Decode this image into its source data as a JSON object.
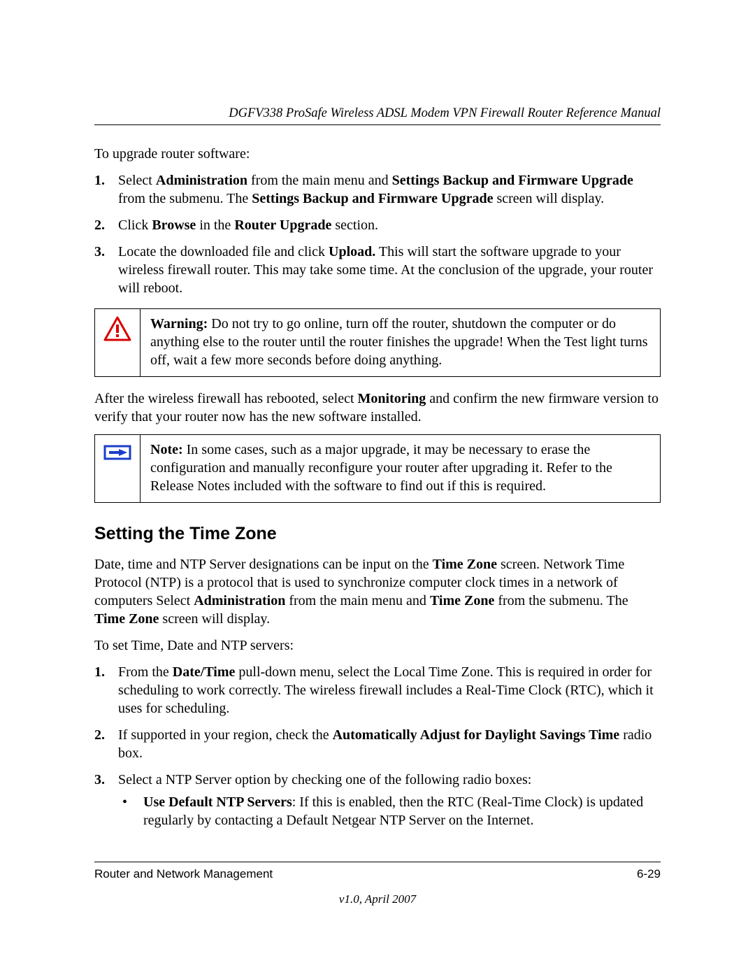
{
  "header": {
    "title": "DGFV338 ProSafe Wireless ADSL Modem VPN Firewall Router Reference Manual"
  },
  "intro": "To upgrade router software:",
  "steps1": {
    "s1": {
      "num": "1.",
      "t1": "Select ",
      "b1": "Administration",
      "t2": " from the main menu and ",
      "b2": "Settings Backup and Firmware Upgrade",
      "t3": " from the submenu. The ",
      "b3": "Settings Backup and Firmware Upgrade",
      "t4": " screen will display."
    },
    "s2": {
      "num": "2.",
      "t1": "Click ",
      "b1": "Browse",
      "t2": " in the ",
      "b2": "Router Upgrade",
      "t3": " section."
    },
    "s3": {
      "num": "3.",
      "t1": "Locate the downloaded file and click ",
      "b1": "Upload.",
      "t2": " This will start the software upgrade to your wireless firewall router. This may take some time. At the conclusion of the upgrade, your router will reboot."
    }
  },
  "warningBox": {
    "label": "Warning:",
    "text": " Do not try to go online, turn off the router, shutdown the computer or do anything else to the router until the router finishes the upgrade! When the Test light turns off, wait a few more seconds before doing anything."
  },
  "afterWarning": {
    "t1": "After the wireless firewall has rebooted, select ",
    "b1": "Monitoring",
    "t2": " and confirm the new firmware version to verify that your router now has the new software installed."
  },
  "noteBox": {
    "label": "Note:",
    "text": " In some cases, such as a major upgrade, it may be necessary to erase the configuration and manually reconfigure your router after upgrading it. Refer to the Release Notes included with the software to find out if this is required."
  },
  "section": {
    "heading": "Setting the Time Zone",
    "p1": {
      "t1": "Date, time and NTP Server designations can be input on the ",
      "b1": "Time Zone",
      "t2": " screen. Network Time Protocol (NTP) is a protocol that is used to synchronize computer clock times in a network of computers Select ",
      "b2": "Administration",
      "t3": " from the main menu and ",
      "b3": "Time Zone",
      "t4": " from the submenu. The ",
      "b4": "Time Zone",
      "t5": " screen will display."
    },
    "p2": "To set Time, Date and NTP servers:"
  },
  "steps2": {
    "s1": {
      "num": "1.",
      "t1": "From the ",
      "b1": "Date/Time",
      "t2": " pull-down menu, select the Local Time Zone. This is required in order for scheduling to work correctly. The wireless firewall includes a Real-Time Clock (RTC), which it uses for scheduling."
    },
    "s2": {
      "num": "2.",
      "t1": "If supported in your region, check the ",
      "b1": "Automatically Adjust for Daylight Savings Time",
      "t2": " radio box."
    },
    "s3": {
      "num": "3.",
      "text": "Select a NTP Server option by checking one of the following radio boxes:",
      "bullet": {
        "dot": "•",
        "b1": "Use Default NTP Servers",
        "t1": ": If this is enabled, then the RTC (Real-Time Clock) is updated regularly by contacting a Default Netgear NTP Server on the Internet."
      }
    }
  },
  "footer": {
    "left": "Router and Network Management",
    "right": "6-29",
    "version": "v1.0, April 2007"
  }
}
